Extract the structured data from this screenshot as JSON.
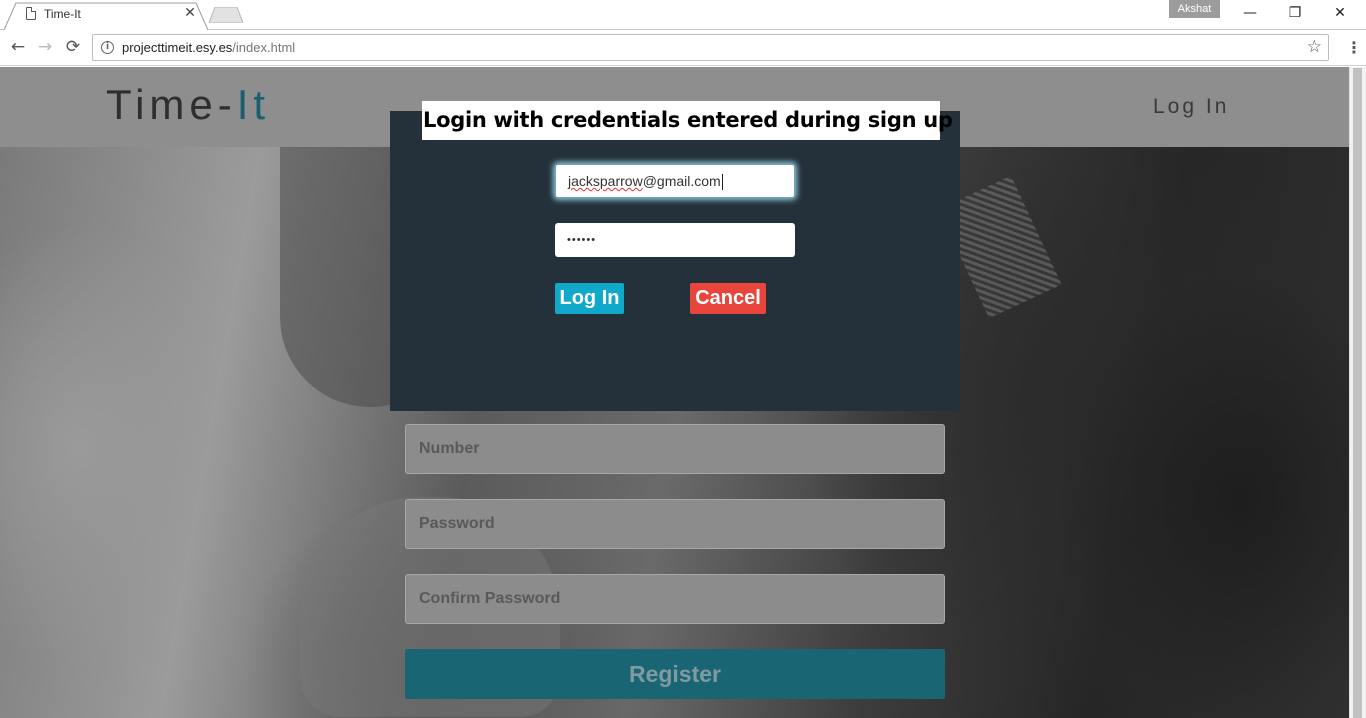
{
  "browser": {
    "tab_title": "Time-It",
    "tab_close": "✕",
    "profile_name": "Akshat",
    "window_minimize": "—",
    "window_restore": "❐",
    "window_close": "✕",
    "back": "←",
    "forward": "→",
    "reload": "⟳",
    "url_host": "projecttimeit.esy.es",
    "url_path": "/index.html",
    "info_glyph": "i",
    "star": "☆",
    "menu": "⋮"
  },
  "site": {
    "logo_main": "Time-",
    "logo_accent": "It",
    "header_login": "Log In"
  },
  "register_form": {
    "number_placeholder": "Number",
    "password_placeholder": "Password",
    "confirm_placeholder": "Confirm Password",
    "register_label": "Register"
  },
  "annotation": "Login with credentials entered during sign up",
  "login_modal": {
    "email_value_underlined": "jacksparrow",
    "email_value_rest": "@gmail.com",
    "password_value": "••••••",
    "login_label": "Log In",
    "cancel_label": "Cancel"
  },
  "colors": {
    "modal_bg": "#24313a",
    "login_btn": "#11a9c9",
    "cancel_btn": "#e8453c",
    "register_btn": "#1a6573"
  }
}
